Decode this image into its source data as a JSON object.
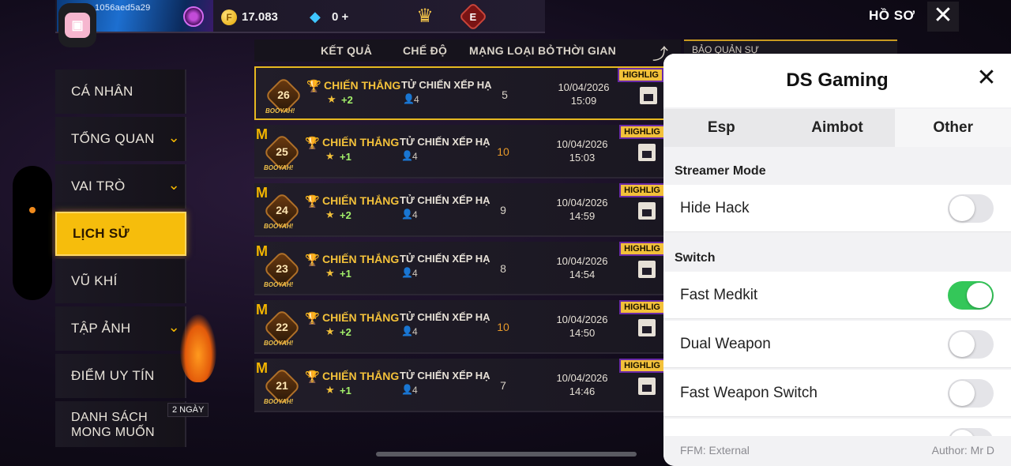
{
  "topbar": {
    "player_uid": "1056aed5a29",
    "coins": "17.083",
    "diamonds": "0",
    "diamonds_plus": "+",
    "profile_label": "HỒ SƠ",
    "close_glyph": "✕",
    "elite_letter": "E",
    "coin_letter": "F"
  },
  "menu": {
    "items": [
      {
        "label": "CÁ NHÂN",
        "chevron": false
      },
      {
        "label": "TỔNG QUAN",
        "chevron": true
      },
      {
        "label": "VAI TRÒ",
        "chevron": true
      },
      {
        "label": "LỊCH SỬ",
        "chevron": false,
        "active": true
      },
      {
        "label": "VŨ KHÍ",
        "chevron": false
      },
      {
        "label": "TẬP ẢNH",
        "chevron": true
      },
      {
        "label": "ĐIỂM UY TÍN",
        "chevron": false
      },
      {
        "label": "DANH SÁCH MONG MUỐN",
        "chevron": false
      }
    ],
    "wishlist_line1": "DANH SÁCH",
    "wishlist_line2": "MONG MUỐN",
    "badge_2days": "2 NGÀY"
  },
  "table": {
    "headers": {
      "result": "KẾT QUẢ",
      "mode": "CHẾ ĐỘ",
      "kills": "MẠNG LOẠI BỎ",
      "time": "THỜI GIAN"
    },
    "rows": [
      {
        "rank": "26",
        "result": "CHIẾN THẮNG",
        "points": "+2",
        "mode": "TỬ CHIẾN XẾP HẠ",
        "team": "4",
        "kills": "5",
        "date": "10/04/2026",
        "time": "15:09",
        "tag": "HIGHLIG",
        "kills_color": "white"
      },
      {
        "rank": "25",
        "result": "CHIẾN THẮNG",
        "points": "+1",
        "mode": "TỬ CHIẾN XẾP HẠ",
        "team": "4",
        "kills": "10",
        "date": "10/04/2026",
        "time": "15:03",
        "tag": "HIGHLIG",
        "kills_color": "orange"
      },
      {
        "rank": "24",
        "result": "CHIẾN THẮNG",
        "points": "+2",
        "mode": "TỬ CHIẾN XẾP HẠ",
        "team": "4",
        "kills": "9",
        "date": "10/04/2026",
        "time": "14:59",
        "tag": "HIGHLIG",
        "kills_color": "white"
      },
      {
        "rank": "23",
        "result": "CHIẾN THẮNG",
        "points": "+1",
        "mode": "TỬ CHIẾN XẾP HẠ",
        "team": "4",
        "kills": "8",
        "date": "10/04/2026",
        "time": "14:54",
        "tag": "HIGHLIG",
        "kills_color": "white"
      },
      {
        "rank": "22",
        "result": "CHIẾN THẮNG",
        "points": "+2",
        "mode": "TỬ CHIẾN XẾP HẠ",
        "team": "4",
        "kills": "10",
        "date": "10/04/2026",
        "time": "14:50",
        "tag": "HIGHLIG",
        "kills_color": "orange"
      },
      {
        "rank": "21",
        "result": "CHIẾN THẮNG",
        "points": "+1",
        "mode": "TỬ CHIẾN XẾP HẠ",
        "team": "4",
        "kills": "7",
        "date": "10/04/2026",
        "time": "14:46",
        "tag": "HIGHLIG",
        "kills_color": "white"
      }
    ],
    "booyah_text": "BOOYAH!"
  },
  "bg_panel_label": "BẢO QUẢN SỰ",
  "panel": {
    "title": "DS Gaming",
    "close_glyph": "✕",
    "tabs": [
      "Esp",
      "Aimbot",
      "Other"
    ],
    "active_tab": "Other",
    "sections": [
      {
        "label": "Streamer Mode",
        "options": [
          {
            "label": "Hide Hack",
            "on": false
          }
        ]
      },
      {
        "label": "Switch",
        "options": [
          {
            "label": "Fast Medkit",
            "on": true
          },
          {
            "label": "Dual Weapon",
            "on": false
          },
          {
            "label": "Fast Weapon Switch",
            "on": false
          }
        ]
      }
    ],
    "footer_left": "FFM: External",
    "footer_right": "Author: Mr D"
  },
  "colors": {
    "accent_gold": "#f6bd0c",
    "toggle_on": "#34c759",
    "kills_orange": "#e89a2a"
  }
}
